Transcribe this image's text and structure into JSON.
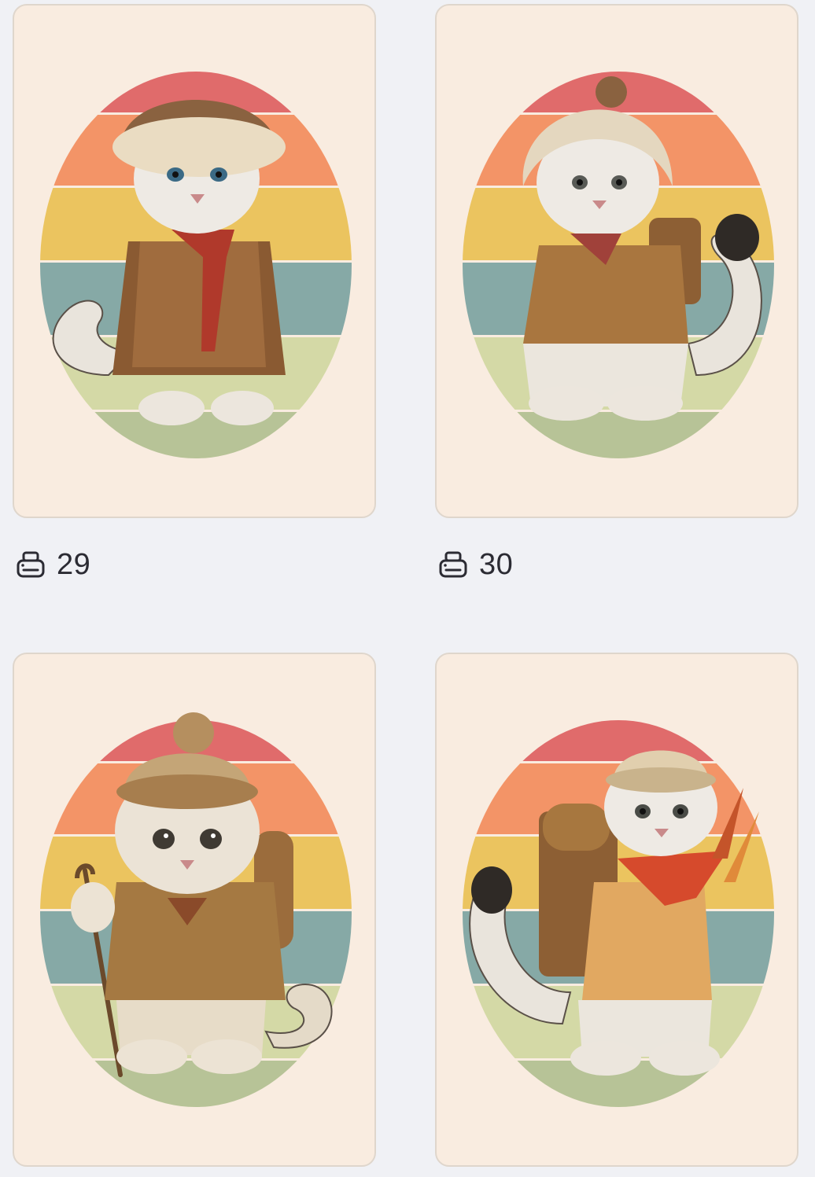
{
  "items": [
    {
      "print_count": "29",
      "icon": "printer-icon"
    },
    {
      "print_count": "30",
      "icon": "printer-icon"
    },
    {
      "print_count": "",
      "icon": "printer-icon"
    },
    {
      "print_count": "",
      "icon": "printer-icon"
    }
  ],
  "colors": {
    "page_bg": "#f0f1f5",
    "card_bg": "#f9ece0",
    "stripe_red": "#e06b6b",
    "stripe_orange": "#f39467",
    "stripe_yellow": "#ebc45f",
    "stripe_teal": "#86a9a6",
    "stripe_sage": "#d4d9a6",
    "stripe_green": "#b7c397"
  }
}
